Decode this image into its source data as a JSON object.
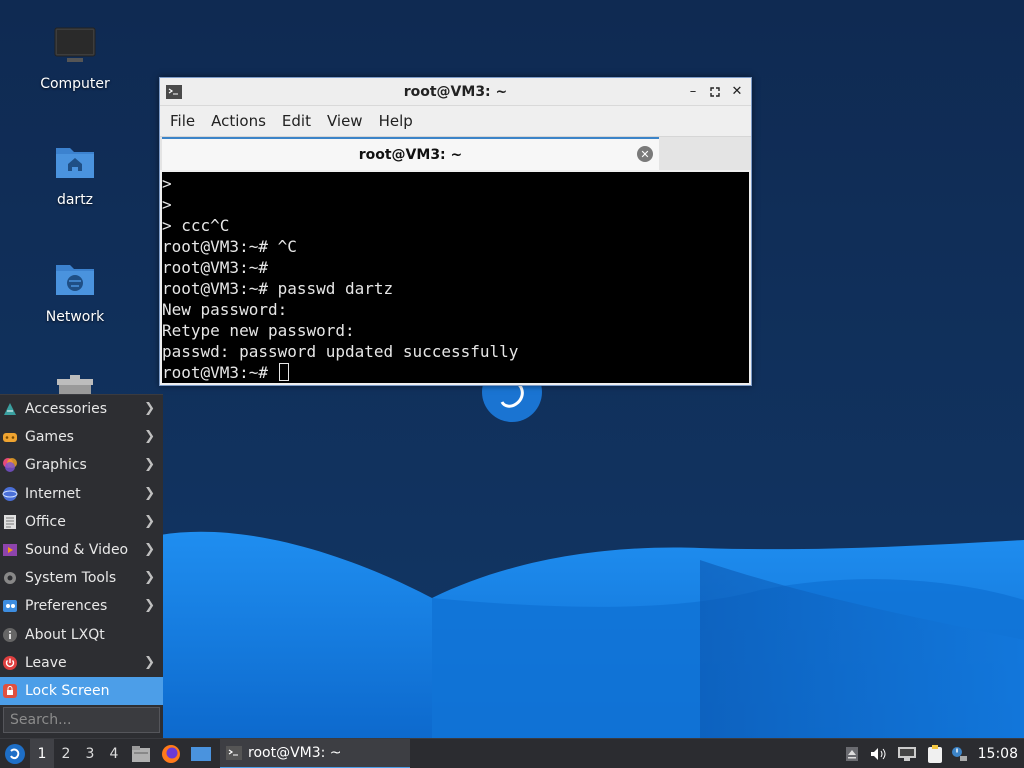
{
  "desktop": {
    "icons": [
      {
        "label": "Computer",
        "icon": "computer-icon"
      },
      {
        "label": "dartz",
        "icon": "home-folder-icon"
      },
      {
        "label": "Network",
        "icon": "network-folder-icon"
      },
      {
        "label": "",
        "icon": "trash-icon"
      }
    ]
  },
  "terminal": {
    "window_title": "root@VM3: ~",
    "menu": [
      "File",
      "Actions",
      "Edit",
      "View",
      "Help"
    ],
    "tab_title": "root@VM3: ~",
    "lines": [
      ">",
      ">",
      "> ccc^C",
      "root@VM3:~# ^C",
      "root@VM3:~#",
      "root@VM3:~# passwd dartz",
      "New password:",
      "Retype new password:",
      "passwd: password updated successfully",
      "root@VM3:~# "
    ]
  },
  "app_menu": {
    "items": [
      {
        "label": "Accessories",
        "icon": "accessories-icon",
        "submenu": true
      },
      {
        "label": "Games",
        "icon": "games-icon",
        "submenu": true
      },
      {
        "label": "Graphics",
        "icon": "graphics-icon",
        "submenu": true
      },
      {
        "label": "Internet",
        "icon": "internet-icon",
        "submenu": true
      },
      {
        "label": "Office",
        "icon": "office-icon",
        "submenu": true
      },
      {
        "label": "Sound & Video",
        "icon": "sound-video-icon",
        "submenu": true
      },
      {
        "label": "System Tools",
        "icon": "system-tools-icon",
        "submenu": true
      },
      {
        "label": "Preferences",
        "icon": "preferences-icon",
        "submenu": true
      },
      {
        "label": "About LXQt",
        "icon": "info-icon",
        "submenu": false
      },
      {
        "label": "Leave",
        "icon": "power-icon",
        "submenu": true
      },
      {
        "label": "Lock Screen",
        "icon": "lock-icon",
        "submenu": false,
        "active": true
      }
    ],
    "search_placeholder": "Search..."
  },
  "taskbar": {
    "workspaces": [
      "1",
      "2",
      "3",
      "4"
    ],
    "active_workspace": "1",
    "task_label": "root@VM3: ~",
    "clock": "15:08"
  },
  "colors": {
    "accent": "#4c9ee8",
    "panel": "#2b2c30",
    "desktop_bg": "#0f2c55"
  }
}
